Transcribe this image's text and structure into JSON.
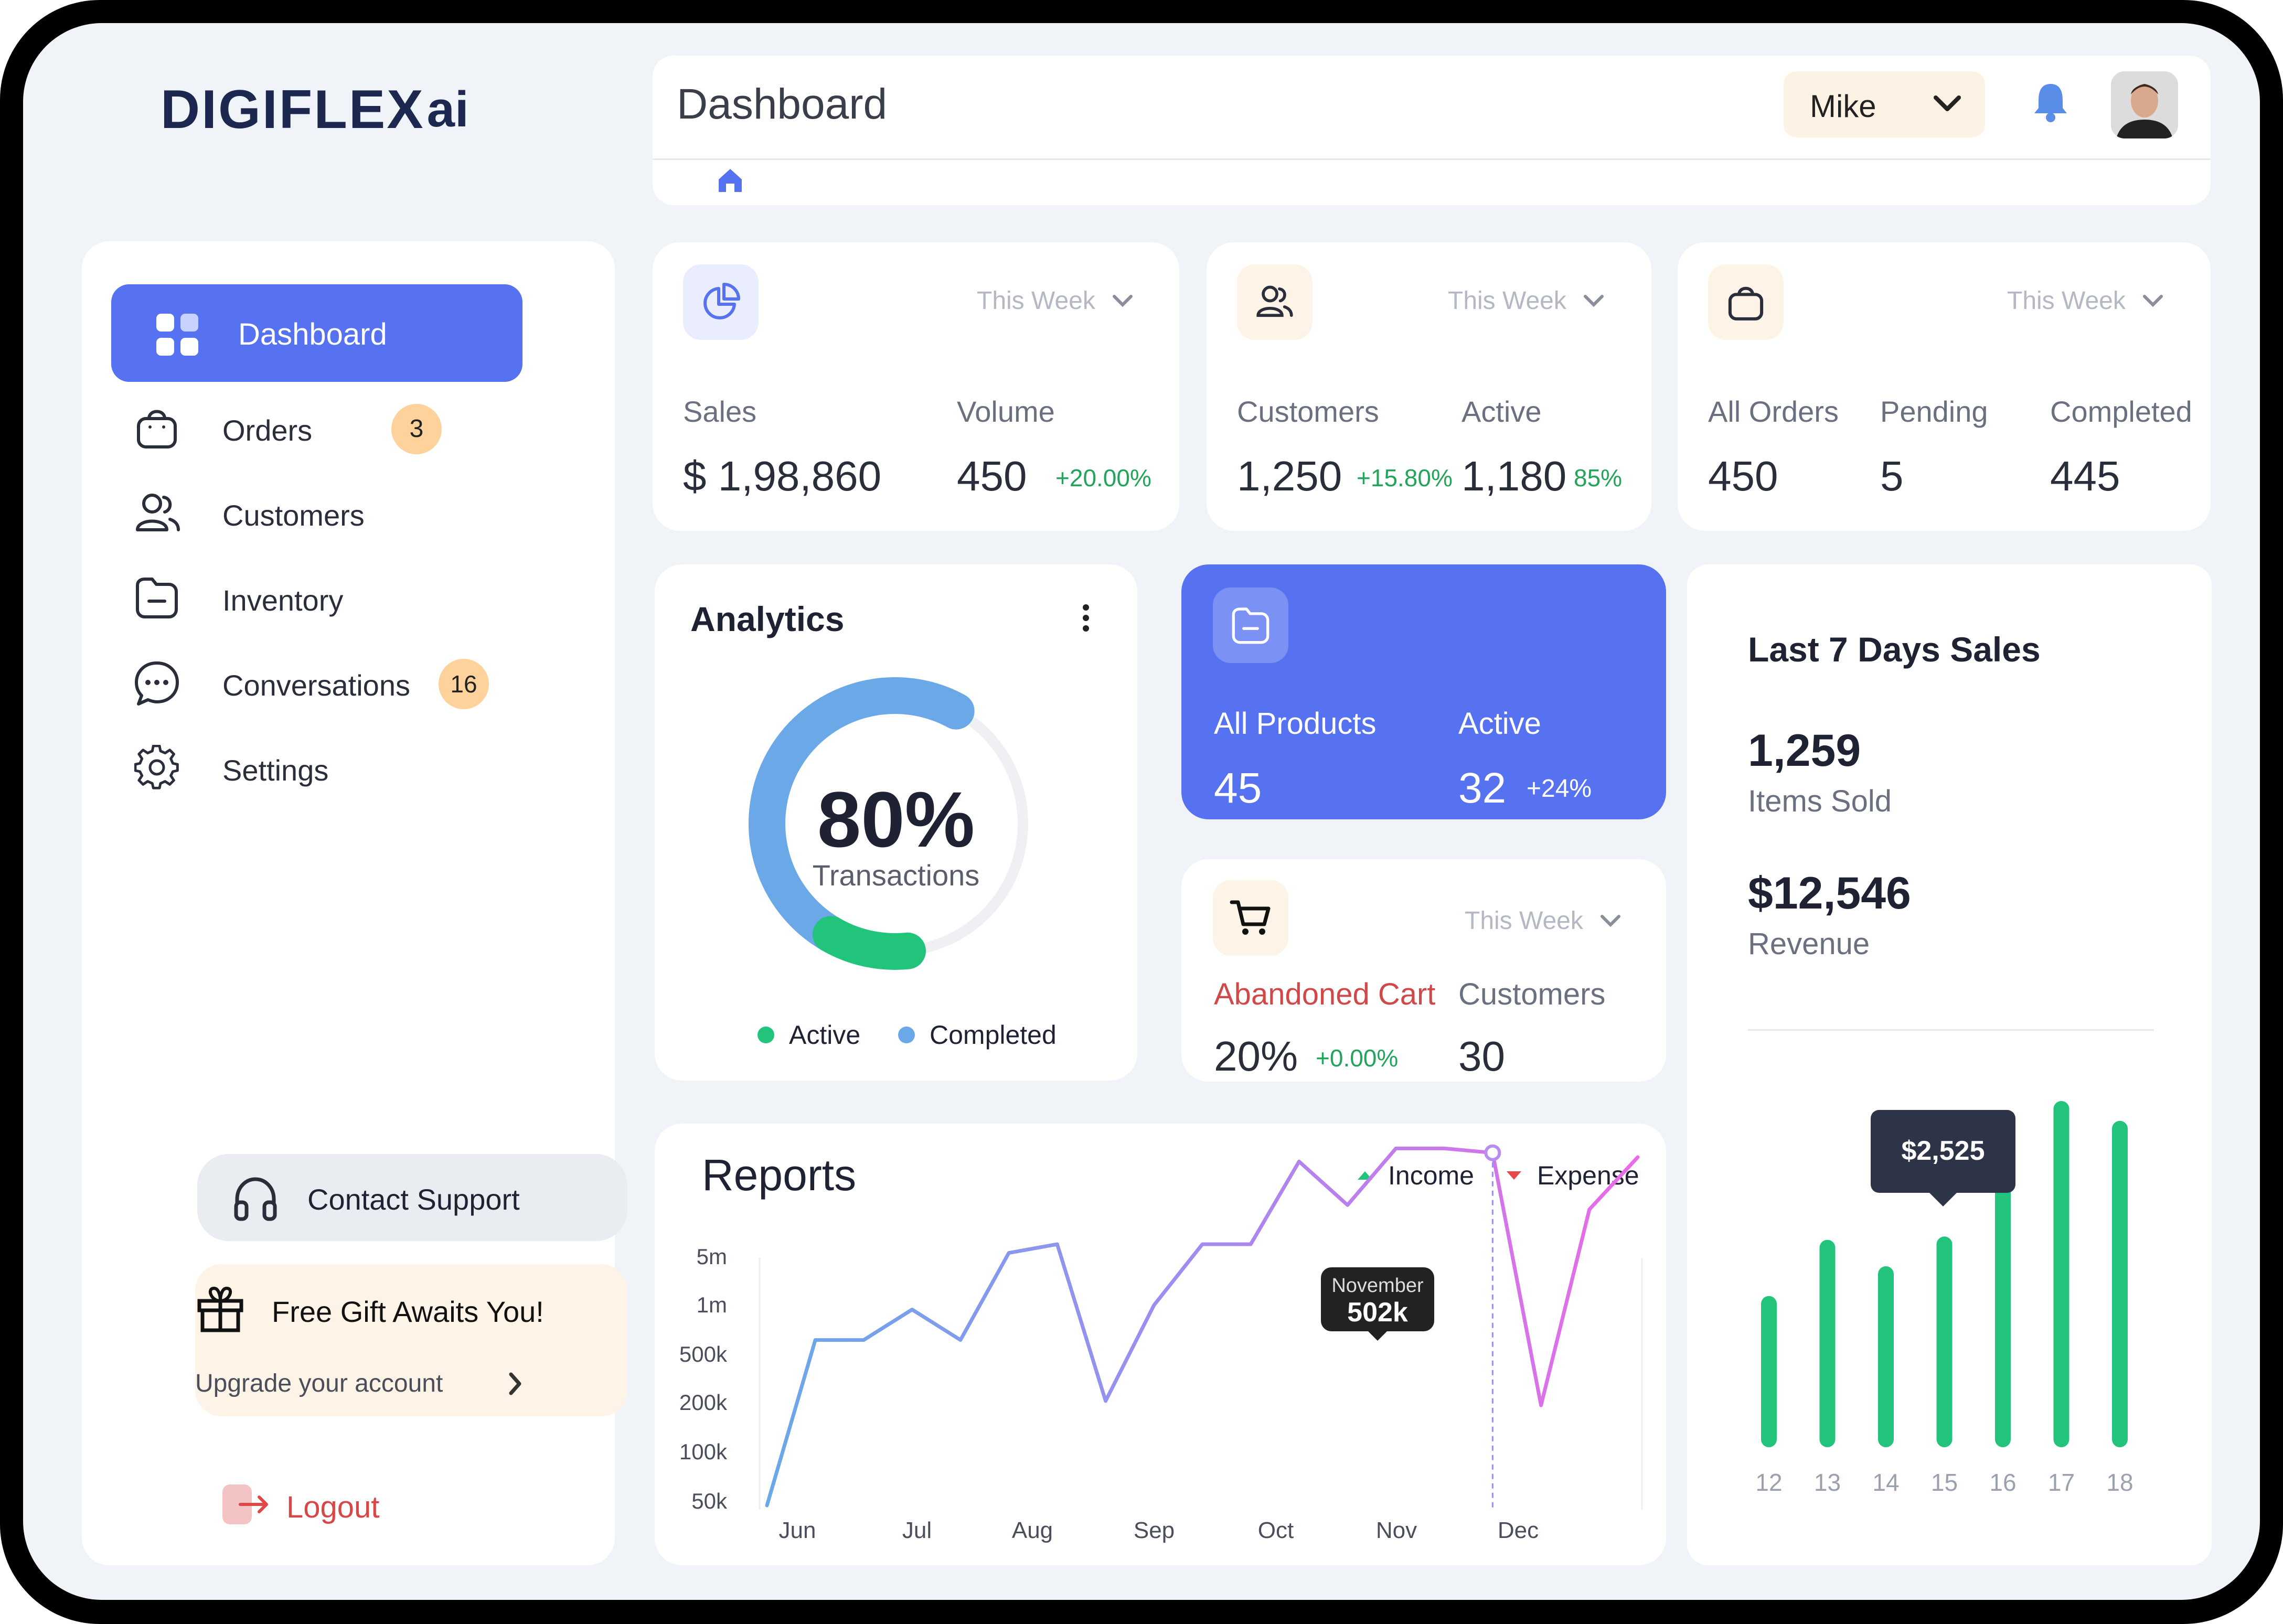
{
  "brand": {
    "logo_text": "DIGIFLEX",
    "logo_suffix": "ai"
  },
  "header": {
    "title": "Dashboard",
    "user_name": "Mike",
    "breadcrumb_icon": "home-icon"
  },
  "sidebar": {
    "items": [
      {
        "label": "Dashboard",
        "icon": "grid-icon",
        "active": true
      },
      {
        "label": "Orders",
        "icon": "bag-icon",
        "badge": "3"
      },
      {
        "label": "Customers",
        "icon": "users-icon"
      },
      {
        "label": "Inventory",
        "icon": "folder-icon"
      },
      {
        "label": "Conversations",
        "icon": "chat-icon",
        "badge": "16"
      },
      {
        "label": "Settings",
        "icon": "gear-icon"
      }
    ],
    "contact_support": "Contact Support",
    "gift": {
      "title": "Free Gift Awaits You!",
      "subtitle": "Upgrade your account"
    },
    "logout": "Logout"
  },
  "stats": {
    "sales": {
      "period": "This Week",
      "label1": "Sales",
      "value1": "$ 1,98,860",
      "label2": "Volume",
      "value2": "450",
      "delta2": "+20.00%"
    },
    "customers": {
      "period": "This Week",
      "label1": "Customers",
      "value1": "1,250",
      "delta1": "+15.80%",
      "label2": "Active",
      "value2": "1,180",
      "delta2": "85%"
    },
    "orders": {
      "period": "This Week",
      "label1": "All Orders",
      "value1": "450",
      "label2": "Pending",
      "value2": "5",
      "label3": "Completed",
      "value3": "445"
    }
  },
  "analytics": {
    "title": "Analytics",
    "percent": "80%",
    "caption": "Transactions",
    "legend_active": "Active",
    "legend_completed": "Completed",
    "completed_fraction": 0.8,
    "active_fraction": 0.18
  },
  "products": {
    "label1": "All Products",
    "value1": "45",
    "label2": "Active",
    "value2": "32",
    "delta2": "+24%"
  },
  "cart": {
    "period": "This Week",
    "label1": "Abandoned Cart",
    "value1": "20%",
    "delta1": "+0.00%",
    "label2": "Customers",
    "value2": "30"
  },
  "last7": {
    "title": "Last 7 Days Sales",
    "items_value": "1,259",
    "items_label": "Items Sold",
    "revenue_value": "$12,546",
    "revenue_label": "Revenue",
    "tooltip": "$2,525"
  },
  "reports": {
    "title": "Reports",
    "legend_income": "Income",
    "legend_expense": "Expense",
    "tooltip_month": "November",
    "tooltip_value": "502k"
  },
  "colors": {
    "primary": "#5772f0",
    "green": "#22c37a",
    "blue": "#6aa8e8",
    "pink": "#e86ae8",
    "badge": "#fdd39b"
  },
  "chart_data": [
    {
      "type": "line",
      "title": "Reports",
      "y_ticks": [
        "5m",
        "1m",
        "500k",
        "200k",
        "100k",
        "50k"
      ],
      "x_ticks": [
        "Jun",
        "Jul",
        "Aug",
        "Sep",
        "Oct",
        "Nov",
        "Dec"
      ],
      "series": [
        {
          "name": "Income",
          "values": [
            0,
            1.9,
            1.9,
            2.25,
            1.9,
            2.9,
            3.0,
            1.2,
            2.3,
            3.0,
            3.0,
            3.95,
            3.45,
            4.1,
            4.1,
            4.05,
            1.15,
            3.4,
            4.0
          ]
        }
      ],
      "highlight": {
        "label": "November",
        "value": "502k"
      }
    },
    {
      "type": "bar",
      "title": "Last 7 Days Sales",
      "categories": [
        "12",
        "13",
        "14",
        "15",
        "16",
        "17",
        "18"
      ],
      "values": [
        0.41,
        0.58,
        0.5,
        0.59,
        0.86,
        1.0,
        0.94
      ],
      "highlight": {
        "category": "15",
        "value": "$2,525"
      }
    }
  ]
}
